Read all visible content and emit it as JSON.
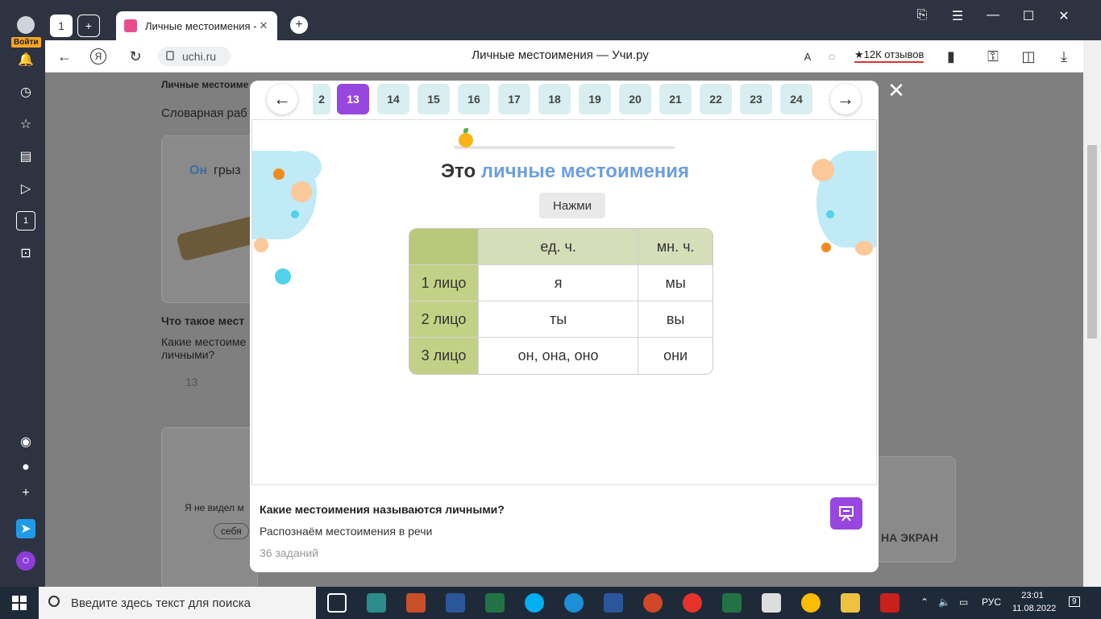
{
  "browser": {
    "login_label": "Войти",
    "tab_title": "Личные местоимения -",
    "url": "uchi.ru",
    "page_title": "Личные местоимения — Учи.ру",
    "reviews": "★12К отзывов",
    "home_badge": "1",
    "sidebar_badge": "1"
  },
  "background_page": {
    "crumb": "Личные местоиме",
    "section": "Словарная раб",
    "card_title_pronoun": "Он",
    "card_title_rest": "грыз",
    "question_title": "Что такое мест",
    "question_text": "Какие местоиме личными?",
    "count": "13",
    "snippet": "Я не видел м",
    "chip": "себя",
    "screen_btn": "НА ЭКРАН"
  },
  "modal": {
    "tasks": [
      "2",
      "13",
      "14",
      "15",
      "16",
      "17",
      "18",
      "19",
      "20",
      "21",
      "22",
      "23",
      "24"
    ],
    "active_task": "13",
    "heading_plain": "Это",
    "heading_highlight": "личные местоимения",
    "hint": "Нажми",
    "table": {
      "headers": [
        "ед. ч.",
        "мн. ч."
      ],
      "rows": [
        {
          "label": "1 лицо",
          "singular": "я",
          "plural": "мы"
        },
        {
          "label": "2 лицо",
          "singular": "ты",
          "plural": "вы"
        },
        {
          "label": "3 лицо",
          "singular": "он, она, оно",
          "plural": "они"
        }
      ]
    },
    "footer": {
      "title": "Какие местоимения называются личными?",
      "subtitle": "Распознаём местоимения в речи",
      "count": "36 заданий"
    }
  },
  "taskbar": {
    "search_placeholder": "Введите здесь текст для поиска",
    "language": "РУС",
    "time": "23:01",
    "date": "11.08.2022",
    "notifications": "9"
  },
  "colors": {
    "accent": "#9747e0",
    "highlight": "#6e9ee0",
    "row_header": "#c3d186",
    "col_header": "#d5ddb9"
  }
}
